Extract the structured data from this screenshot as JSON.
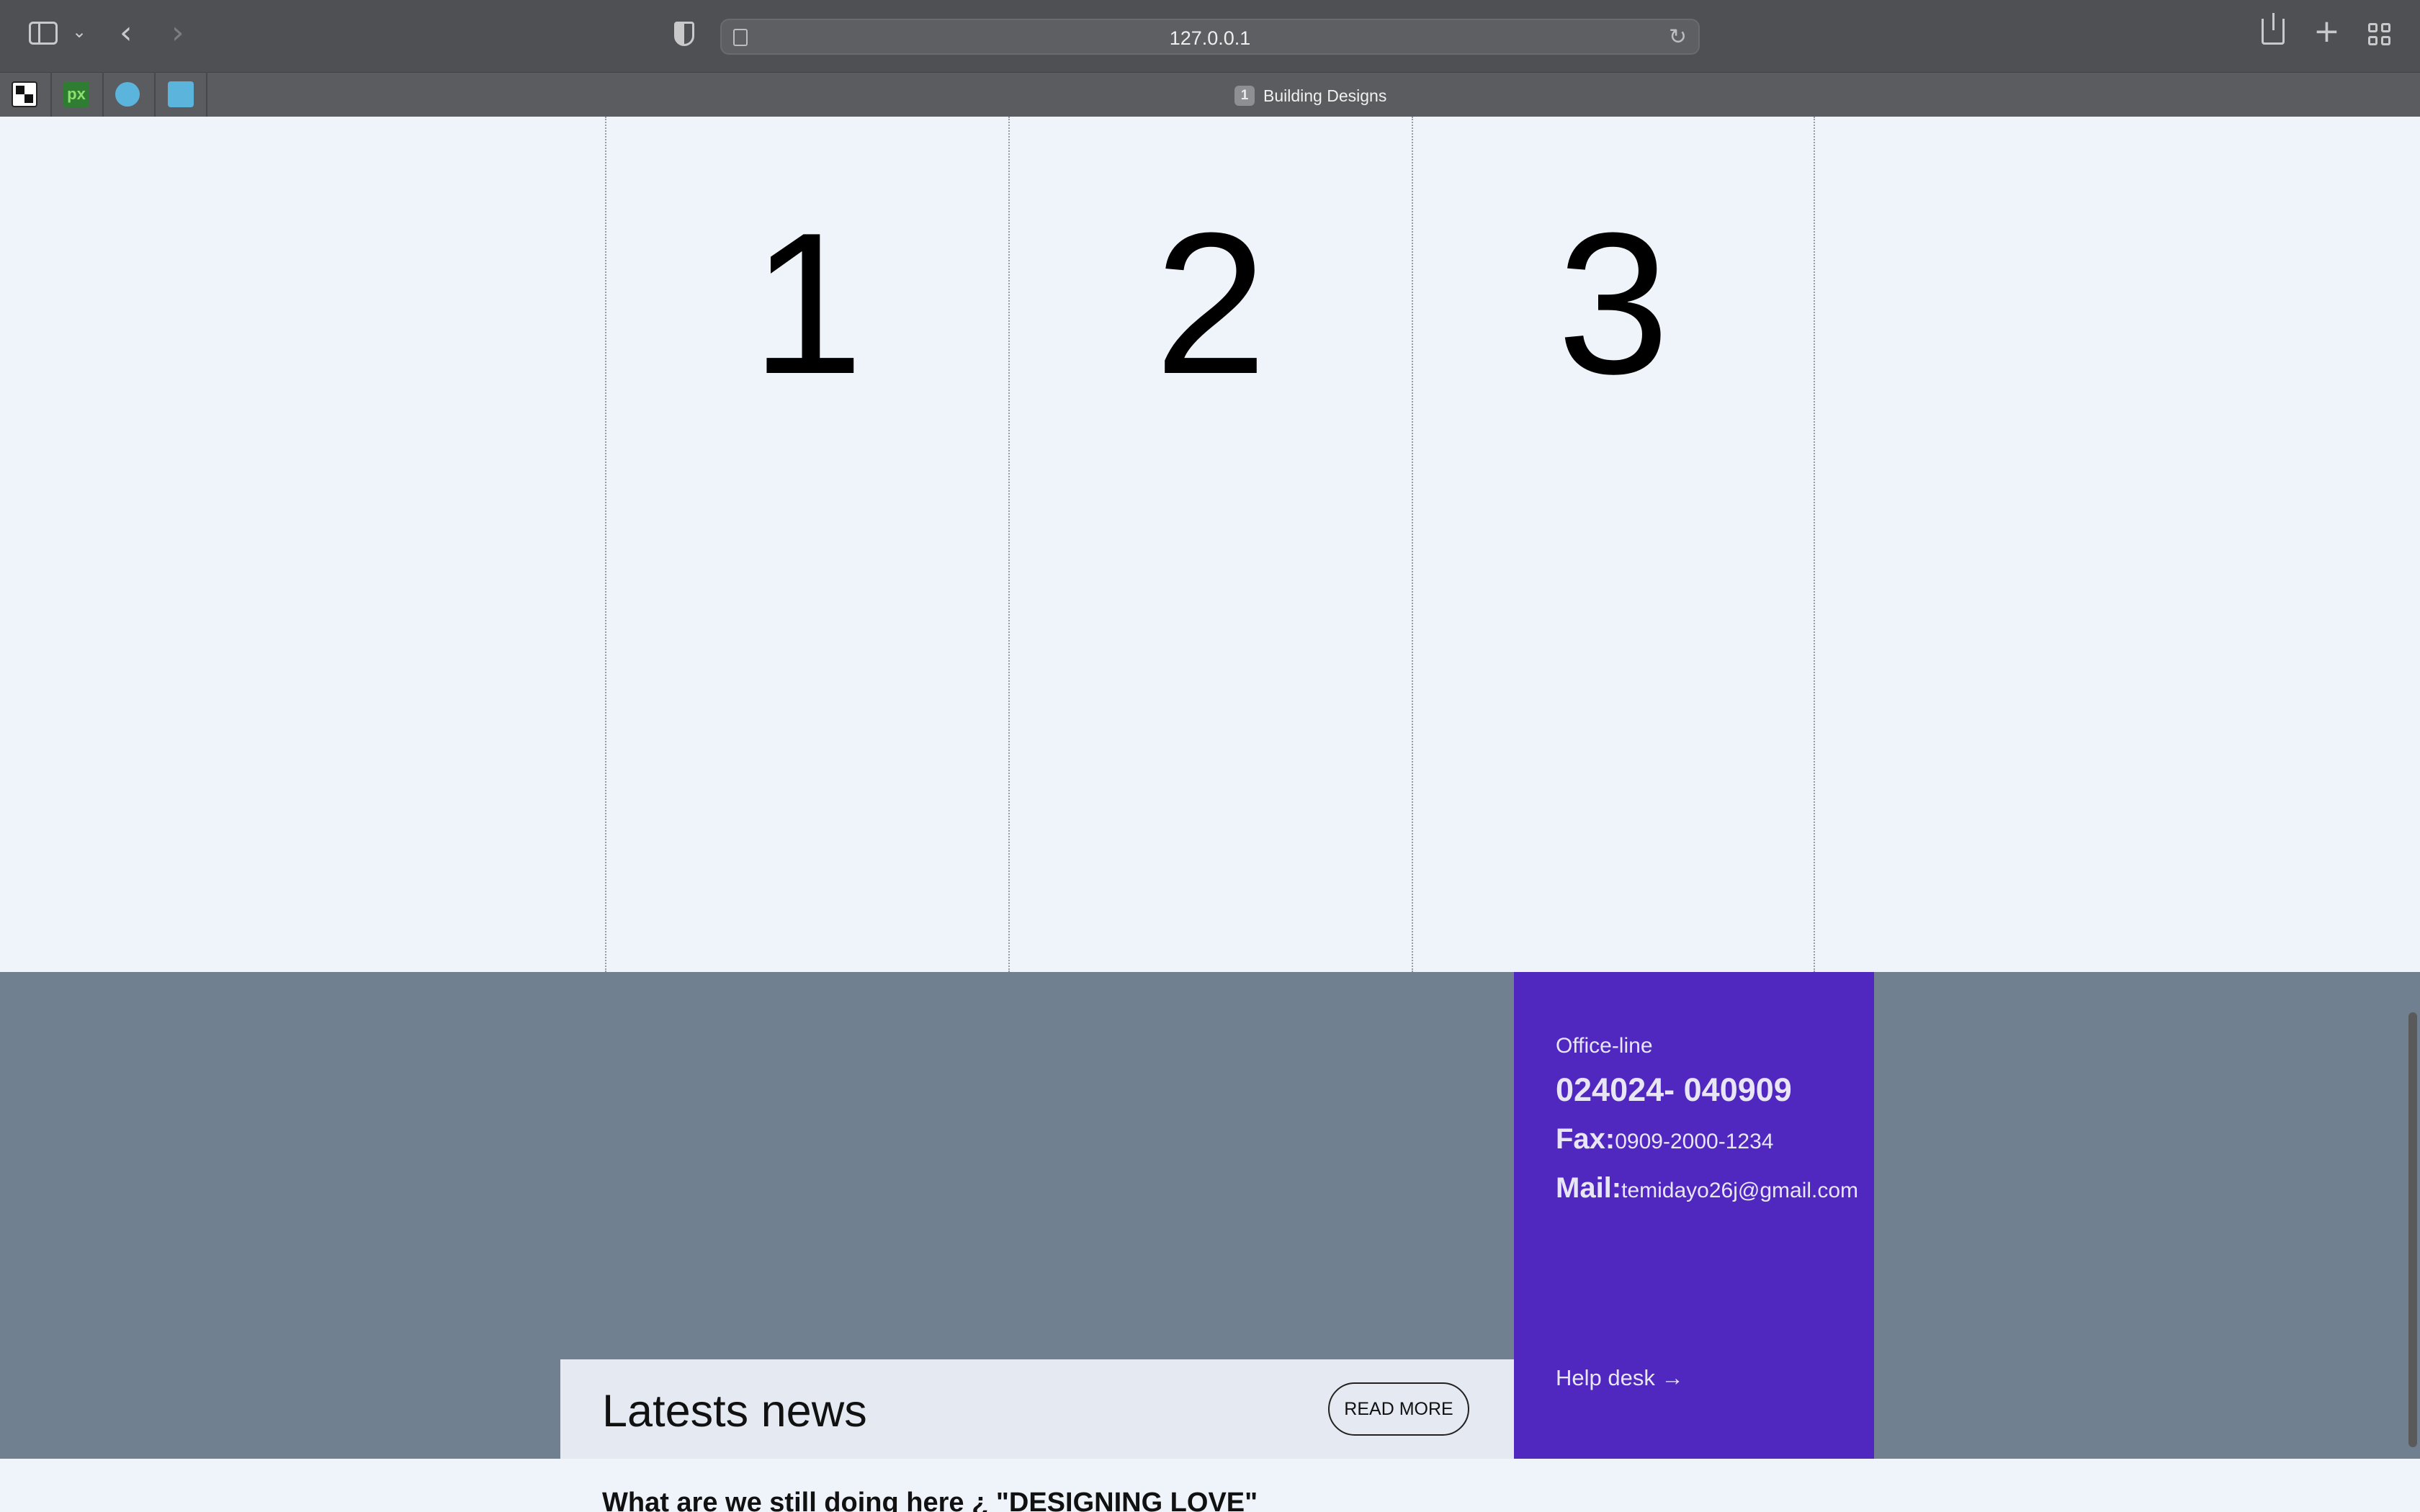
{
  "browser": {
    "url": "127.0.0.1",
    "tab": {
      "number": "1",
      "title": "Building Designs"
    },
    "favicons": [
      {
        "name": "checker-favicon",
        "color": "#ffffff"
      },
      {
        "name": "px-favicon",
        "text": "px",
        "color": "#4caf50"
      },
      {
        "name": "circle-favicon",
        "color": "#5ab4dc"
      },
      {
        "name": "square-favicon",
        "color": "#5ab4dc"
      }
    ],
    "icons": [
      "sidebar-icon",
      "chevron-down-icon",
      "back-icon",
      "forward-icon",
      "shield-icon",
      "page-icon",
      "reload-icon",
      "share-icon",
      "new-tab-icon",
      "tab-overview-icon"
    ]
  },
  "columns": [
    "1",
    "2",
    "3"
  ],
  "contact": {
    "office_label": "Office-line",
    "office_phone": "024024- 040909",
    "fax_label": "Fax:",
    "fax_value": "0909-2000-1234",
    "mail_label": "Mail:",
    "mail_value": "temidayo26j@gmail.com",
    "helpdesk": "Help desk →"
  },
  "news": {
    "title": "Latests news",
    "read_more": "READ MORE",
    "headline": "What are we still doing here ¿ \"DESIGNING LOVE\""
  },
  "colors": {
    "accent": "#5027bf",
    "band": "#718090",
    "page_bg": "#eff3fa"
  }
}
